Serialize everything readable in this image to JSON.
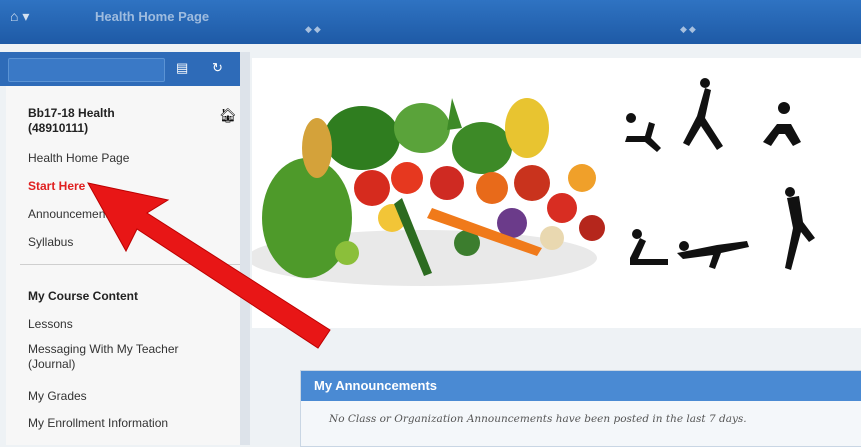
{
  "header": {
    "page_title": "Health Home Page"
  },
  "course_menu": {
    "course_title": "Bb17-18 Health",
    "course_id": "(48910111)",
    "top_links": [
      {
        "label": "Health Home Page"
      },
      {
        "label": "Start Here"
      },
      {
        "label": "Announcements"
      },
      {
        "label": "Syllabus"
      }
    ],
    "section_title": "My Course Content",
    "content_links": [
      {
        "label": "Lessons"
      },
      {
        "label": "Messaging With My Teacher (Journal)"
      },
      {
        "label": "My Grades"
      },
      {
        "label": "My Enrollment Information"
      }
    ]
  },
  "announcements": {
    "title": "My Announcements",
    "message": "No Class or Organization Announcements have been posted in the last 7 days."
  },
  "colors": {
    "header_blue": "#2f73c2",
    "active_link": "#e02020",
    "pointer_arrow": "#e81616"
  },
  "icons": [
    "home-icon",
    "folder-icon",
    "refresh-icon",
    "arrow-pointer"
  ]
}
